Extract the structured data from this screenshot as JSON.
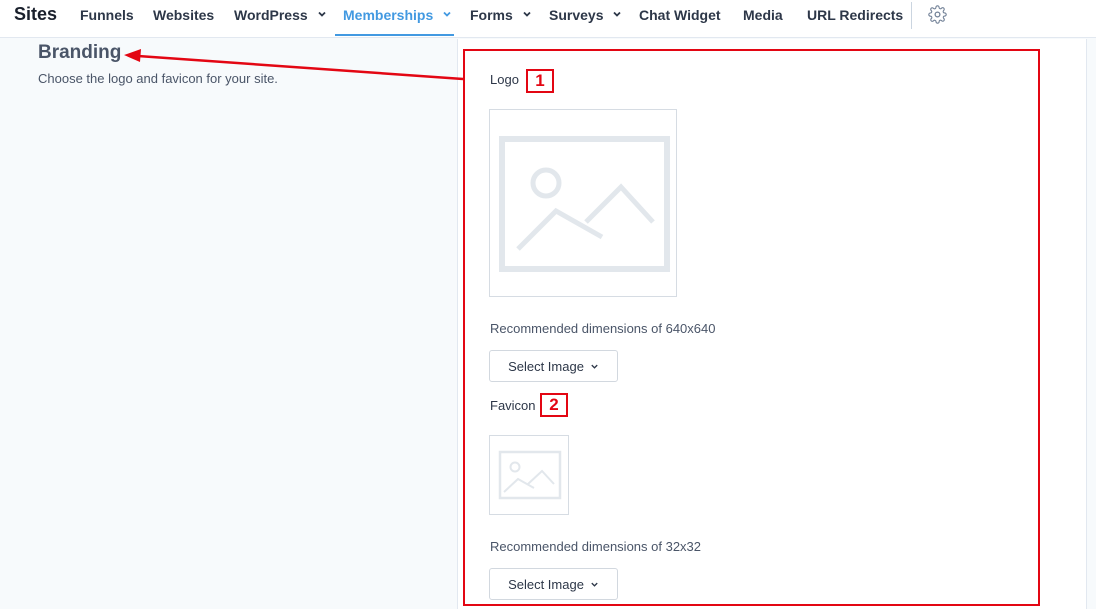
{
  "nav": {
    "brand": "Sites",
    "items": [
      {
        "label": "Funnels",
        "dropdown": false,
        "active": false
      },
      {
        "label": "Websites",
        "dropdown": false,
        "active": false
      },
      {
        "label": "WordPress",
        "dropdown": true,
        "active": false
      },
      {
        "label": "Memberships",
        "dropdown": true,
        "active": true
      },
      {
        "label": "Forms",
        "dropdown": true,
        "active": false
      },
      {
        "label": "Surveys",
        "dropdown": true,
        "active": false
      },
      {
        "label": "Chat Widget",
        "dropdown": false,
        "active": false
      },
      {
        "label": "Media",
        "dropdown": false,
        "active": false
      },
      {
        "label": "URL Redirects",
        "dropdown": false,
        "active": false
      }
    ],
    "settings_icon": "gear-icon",
    "active_color": "#4299e1"
  },
  "branding": {
    "title": "Branding",
    "description": "Choose the logo and favicon for your site."
  },
  "logo": {
    "label": "Logo",
    "callout": "1",
    "placeholder_icon": "image-placeholder-icon",
    "dimensions": "Recommended dimensions of 640x640",
    "button_label": "Select Image"
  },
  "favicon": {
    "label": "Favicon",
    "callout": "2",
    "placeholder_icon": "image-placeholder-icon",
    "dimensions": "Recommended dimensions of 32x32",
    "button_label": "Select Image"
  },
  "annotation_color": "#e30613"
}
